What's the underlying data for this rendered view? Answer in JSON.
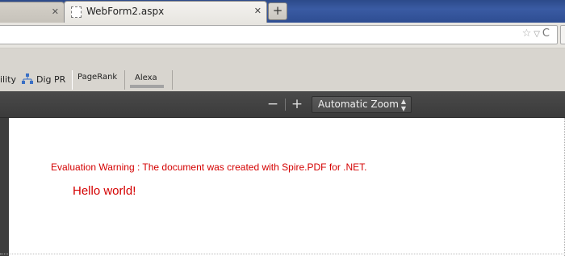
{
  "tabs": {
    "inactive_close": "✕",
    "active_title": "WebForm2.aspx",
    "active_close": "✕",
    "new_tab": "+"
  },
  "urlbar": {
    "value": "",
    "star_icon": "☆",
    "dropdown_icon": "▽",
    "reload_icon": "C"
  },
  "bookmarks": {
    "item1": "ility",
    "item2": "Dig PR",
    "item3": "PageRank",
    "item4": "Alexa"
  },
  "pdf_toolbar": {
    "zoom_out": "−",
    "zoom_in": "+",
    "zoom_value": "Automatic Zoom",
    "zoom_arrows": "▲▼"
  },
  "document": {
    "warning": "Evaluation Warning : The document was created with Spire.PDF for .NET.",
    "body": "Hello world!",
    "text_color": "#d40000"
  }
}
